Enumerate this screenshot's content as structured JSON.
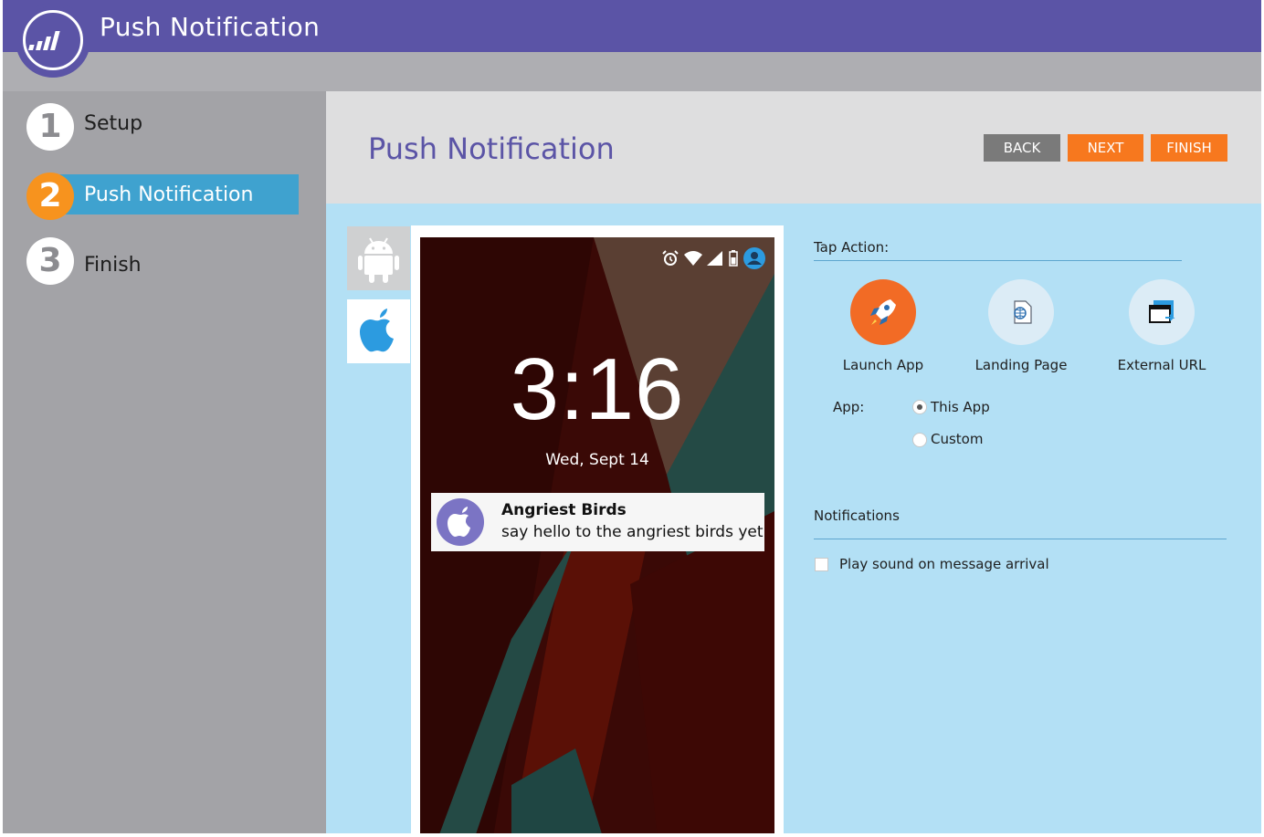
{
  "header": {
    "title": "Push Notification"
  },
  "steps": [
    {
      "number": "1",
      "label": "Setup"
    },
    {
      "number": "2",
      "label": "Push Notification"
    },
    {
      "number": "3",
      "label": "Finish"
    }
  ],
  "page": {
    "title": "Push Notification",
    "buttons": {
      "back": "BACK",
      "next": "NEXT",
      "finish": "FINISH"
    }
  },
  "preview": {
    "platforms": [
      "android-icon",
      "apple-icon"
    ],
    "time": "3:16",
    "date": "Wed, Sept 14",
    "notification": {
      "title": "Angriest Birds",
      "body": "say hello to the angriest birds yet"
    }
  },
  "tap_action": {
    "label": "Tap Action:",
    "options": [
      {
        "label": "Launch App",
        "icon": "rocket-icon"
      },
      {
        "label": "Landing Page",
        "icon": "landing-page-icon"
      },
      {
        "label": "External URL",
        "icon": "external-url-icon"
      }
    ],
    "selected": "Launch App",
    "app_label": "App:",
    "app_options": [
      "This App",
      "Custom"
    ],
    "app_selected": "This App"
  },
  "notifications": {
    "label": "Notifications",
    "play_sound_label": "Play  sound on message arrival",
    "play_sound_checked": false
  },
  "colors": {
    "header": "#5b54a6",
    "active_step": "#3fa2cf",
    "accent_orange": "#f7781e",
    "panel": "#b3e0f5"
  }
}
